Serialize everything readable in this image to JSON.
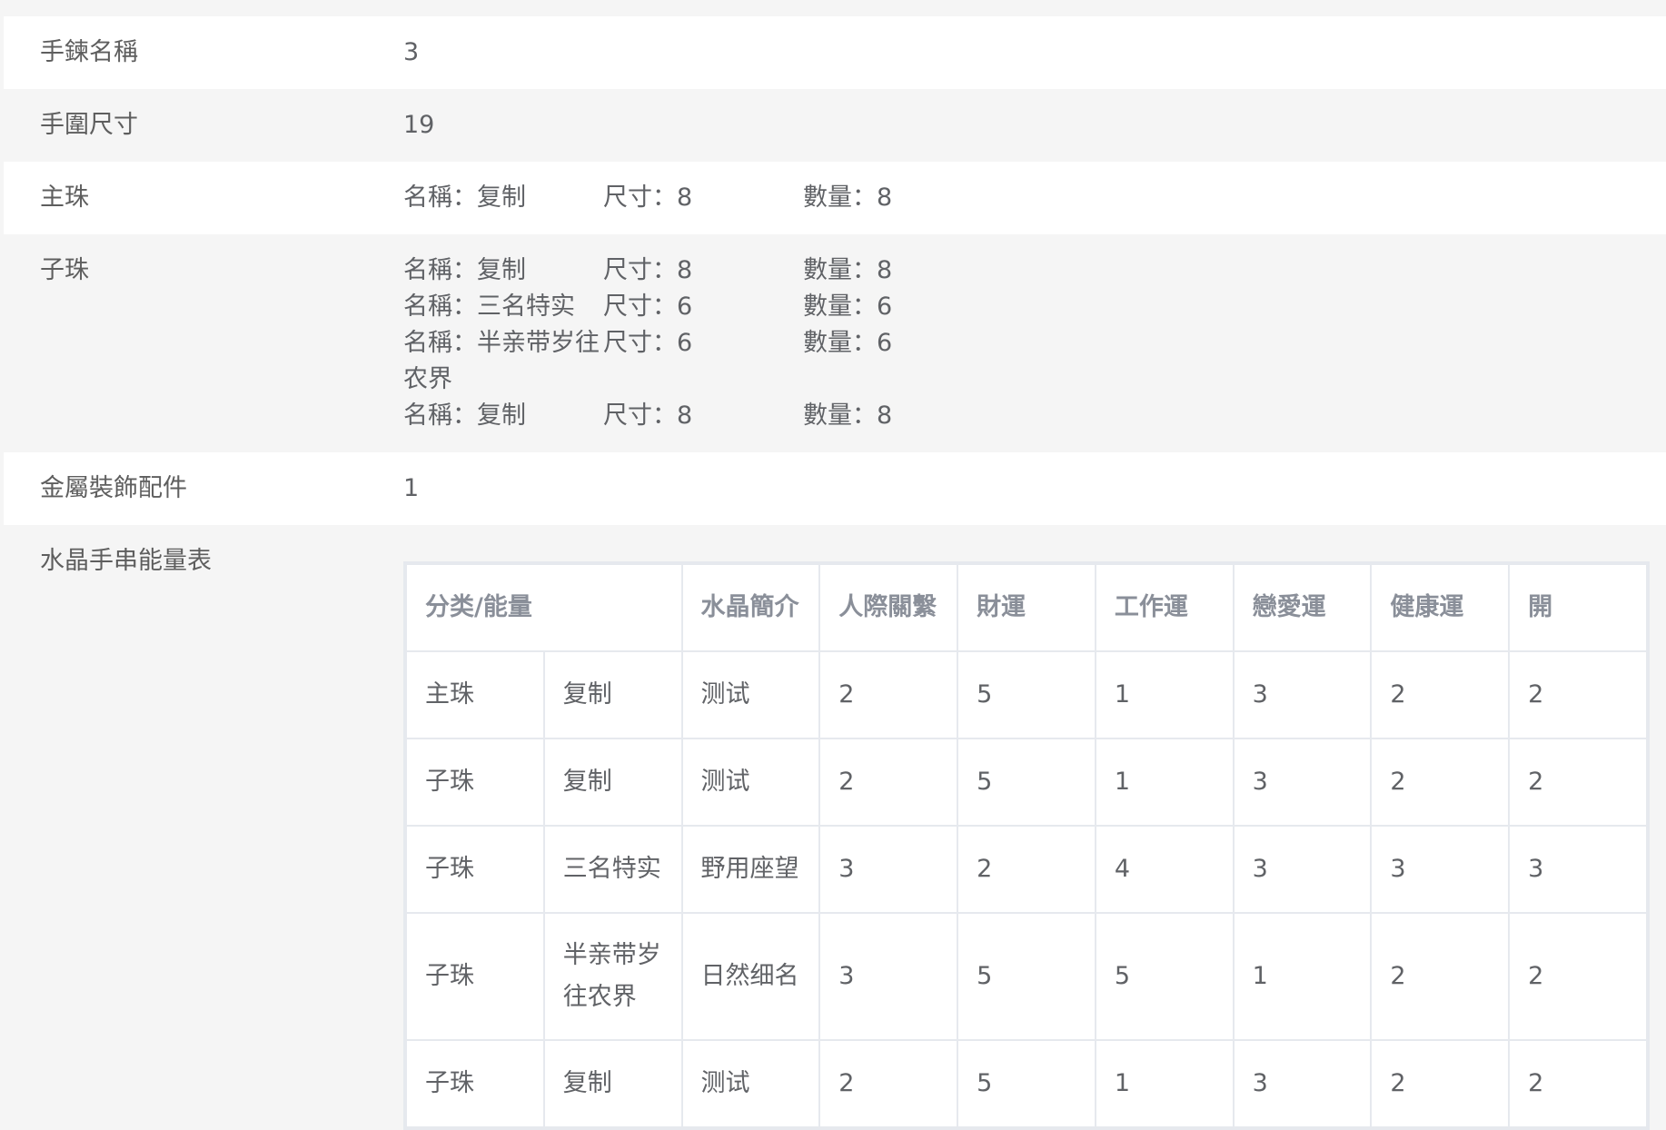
{
  "fields": {
    "bracelet_name_label": "手鍊名稱",
    "bracelet_name_value": "3",
    "wrist_size_label": "手圍尺寸",
    "wrist_size_value": "19",
    "main_bead_label": "主珠",
    "sub_bead_label": "子珠",
    "metal_label": "金屬裝飾配件",
    "metal_value": "1",
    "energy_table_label": "水晶手串能量表"
  },
  "main_bead": {
    "name": "名稱：复制",
    "size": "尺寸：8",
    "qty": "數量：8"
  },
  "sub_beads": [
    {
      "name_prefix": "名稱：",
      "name": "复制",
      "size": "尺寸：8",
      "qty": "數量：8"
    },
    {
      "name_prefix": "名稱：",
      "name": "三名特实",
      "size": "尺寸：6",
      "qty": "數量：6"
    },
    {
      "name_prefix": "名稱：",
      "name": "半亲带岁往农界",
      "size": "尺寸：6",
      "qty": "數量：6"
    },
    {
      "name_prefix": "名稱：",
      "name": "复制",
      "size": "尺寸：8",
      "qty": "數量：8"
    }
  ],
  "energy_table": {
    "headers": [
      "分类/能量",
      "水晶簡介",
      "人際關繫",
      "財運",
      "工作運",
      "戀愛運",
      "健康運",
      "開"
    ],
    "rows": [
      {
        "cat": "主珠",
        "name": "复制",
        "intro": "测试",
        "v": [
          "2",
          "5",
          "1",
          "3",
          "2",
          "2"
        ]
      },
      {
        "cat": "子珠",
        "name": "复制",
        "intro": "测试",
        "v": [
          "2",
          "5",
          "1",
          "3",
          "2",
          "2"
        ]
      },
      {
        "cat": "子珠",
        "name": "三名特实",
        "intro": "野用座望",
        "v": [
          "3",
          "2",
          "4",
          "3",
          "3",
          "3"
        ]
      },
      {
        "cat": "子珠",
        "name": "半亲带岁往农界",
        "intro": "日然细名",
        "v": [
          "3",
          "5",
          "5",
          "1",
          "2",
          "2"
        ]
      },
      {
        "cat": "子珠",
        "name": "复制",
        "intro": "测试",
        "v": [
          "2",
          "5",
          "1",
          "3",
          "2",
          "2"
        ]
      }
    ]
  }
}
